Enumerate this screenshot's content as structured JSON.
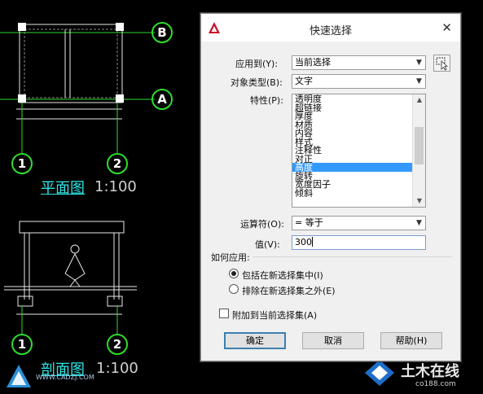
{
  "cad": {
    "plan_title": "平面图",
    "plan_scale": "1:100",
    "section_title": "剖面图",
    "section_scale": "1:100",
    "grid_bubbles": [
      "1",
      "2",
      "1",
      "2"
    ],
    "axis_bubbles": [
      "B",
      "A"
    ]
  },
  "watermark": {
    "left_url": "WWW.CADZJ.COM",
    "right_brand": "土木在线",
    "right_url": "co188.com"
  },
  "dialog": {
    "title": "快速选择",
    "close_label": "✕",
    "apply_to_label": "应用到(Y):",
    "apply_to_value": "当前选择",
    "object_type_label": "对象类型(B):",
    "object_type_value": "文字",
    "properties_label": "特性(P):",
    "properties": [
      {
        "label": "透明度",
        "selected": false
      },
      {
        "label": "超链接",
        "selected": false
      },
      {
        "label": "厚度",
        "selected": false
      },
      {
        "label": "材质",
        "selected": false
      },
      {
        "label": "内容",
        "selected": false
      },
      {
        "label": "样式",
        "selected": false
      },
      {
        "label": "注释性",
        "selected": false
      },
      {
        "label": "对正",
        "selected": false
      },
      {
        "label": "高度",
        "selected": true
      },
      {
        "label": "旋转",
        "selected": false
      },
      {
        "label": "宽度因子",
        "selected": false
      },
      {
        "label": "倾斜",
        "selected": false
      }
    ],
    "operator_label": "运算符(O):",
    "operator_value": "= 等于",
    "value_label": "值(V):",
    "value_value": "300",
    "how_to_apply_label": "如何应用:",
    "radio_include_label": "包括在新选择集中(I)",
    "radio_exclude_label": "排除在新选择集之外(E)",
    "radio_selected": "include",
    "append_label": "附加到当前选择集(A)",
    "append_checked": false,
    "ok_label": "确定",
    "cancel_label": "取消",
    "help_label": "帮助(H)"
  }
}
